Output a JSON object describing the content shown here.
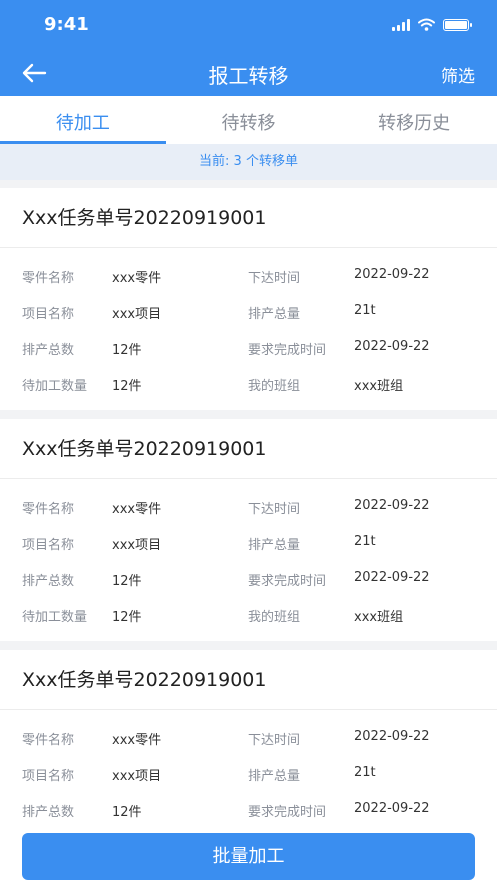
{
  "status_bar": {
    "time": "9:41"
  },
  "navbar": {
    "title": "报工转移",
    "filter_label": "筛选"
  },
  "tabs": [
    {
      "label": "待加工",
      "active": true
    },
    {
      "label": "待转移",
      "active": false
    },
    {
      "label": "转移历史",
      "active": false
    }
  ],
  "notice": "当前: 3 个转移单",
  "cards": [
    {
      "title": "Xxx任务单号20220919001",
      "rows": [
        {
          "l_label": "零件名称",
          "l_value": "xxx零件",
          "r_label": "下达时间",
          "r_value": "2022-09-22"
        },
        {
          "l_label": "项目名称",
          "l_value": "xxx项目",
          "r_label": "排产总量",
          "r_value": "21t"
        },
        {
          "l_label": "排产总数",
          "l_value": "12件",
          "r_label": "要求完成时间",
          "r_value": "2022-09-22"
        },
        {
          "l_label": "待加工数量",
          "l_value": "12件",
          "r_label": "我的班组",
          "r_value": "xxx班组"
        }
      ]
    },
    {
      "title": "Xxx任务单号20220919001",
      "rows": [
        {
          "l_label": "零件名称",
          "l_value": "xxx零件",
          "r_label": "下达时间",
          "r_value": "2022-09-22"
        },
        {
          "l_label": "项目名称",
          "l_value": "xxx项目",
          "r_label": "排产总量",
          "r_value": "21t"
        },
        {
          "l_label": "排产总数",
          "l_value": "12件",
          "r_label": "要求完成时间",
          "r_value": "2022-09-22"
        },
        {
          "l_label": "待加工数量",
          "l_value": "12件",
          "r_label": "我的班组",
          "r_value": "xxx班组"
        }
      ]
    },
    {
      "title": "Xxx任务单号20220919001",
      "rows": [
        {
          "l_label": "零件名称",
          "l_value": "xxx零件",
          "r_label": "下达时间",
          "r_value": "2022-09-22"
        },
        {
          "l_label": "项目名称",
          "l_value": "xxx项目",
          "r_label": "排产总量",
          "r_value": "21t"
        },
        {
          "l_label": "排产总数",
          "l_value": "12件",
          "r_label": "要求完成时间",
          "r_value": "2022-09-22"
        }
      ]
    }
  ],
  "bottom": {
    "batch_label": "批量加工"
  },
  "colors": {
    "primary": "#3a8ef0",
    "background": "#f2f3f5",
    "notice_bg": "#e8eef7"
  },
  "icons": {
    "back": "arrow-left-icon",
    "signal": "cellular-signal-icon",
    "wifi": "wifi-icon",
    "battery": "battery-icon"
  }
}
